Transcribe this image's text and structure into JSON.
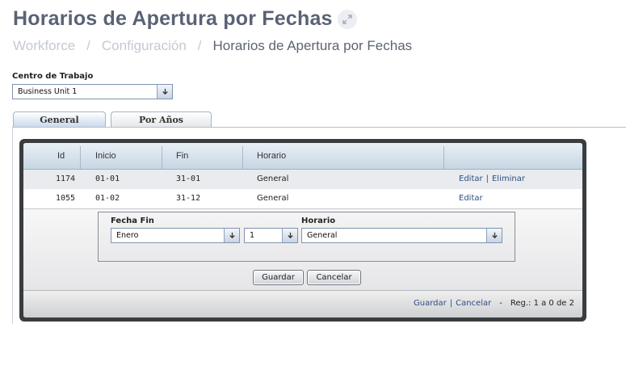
{
  "page": {
    "title": "Horarios de Apertura por Fechas"
  },
  "breadcrumb": {
    "items": [
      "Workforce",
      "Configuración",
      "Horarios de Apertura por Fechas"
    ],
    "separator": "/"
  },
  "centro": {
    "label": "Centro de Trabajo",
    "value": "Business Unit 1"
  },
  "tabs": [
    {
      "label": "General",
      "active": true
    },
    {
      "label": "Por Años",
      "active": false
    }
  ],
  "grid": {
    "columns": [
      "Id",
      "Inicio",
      "Fin",
      "Horario",
      ""
    ],
    "rows": [
      {
        "id": "1174",
        "inicio": "01-01",
        "fin": "31-01",
        "horario": "General",
        "actions": [
          "Editar",
          "Eliminar"
        ]
      },
      {
        "id": "1055",
        "inicio": "01-02",
        "fin": "31-12",
        "horario": "General",
        "actions": [
          "Editar"
        ]
      }
    ],
    "edit_form": {
      "fecha_fin_label": "Fecha Fin",
      "mes_value": "Enero",
      "dia_value": "1",
      "horario_label": "Horario",
      "horario_value": "General",
      "save_button": "Guardar",
      "cancel_button": "Cancelar"
    },
    "footer": {
      "save_link": "Guardar",
      "cancel_link": "Cancelar",
      "dash": "-",
      "records": "Reg.: 1 a 0 de 2"
    }
  },
  "colors": {
    "title": "#5a6275",
    "link": "#2a4f84",
    "grid_frame": "#3a3d40"
  },
  "icons": {
    "expand": "expand-icon",
    "dropdown": "arrow-down-icon"
  }
}
